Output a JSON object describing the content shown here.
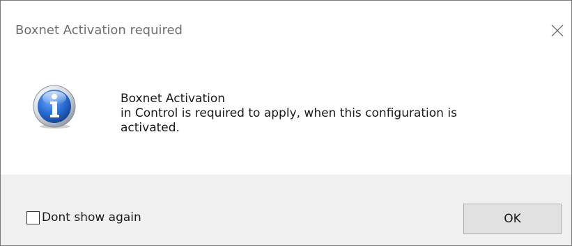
{
  "window": {
    "title": "Boxnet Activation required",
    "close_icon": "close-icon"
  },
  "content": {
    "icon": "info-icon",
    "message_lines": [
      "Boxnet Activation",
      "in Control is required to apply, when this configuration is",
      "activated."
    ]
  },
  "footer": {
    "checkbox_label": "Dont show again",
    "checkbox_checked": false,
    "ok_label": "OK"
  },
  "colors": {
    "title_text": "#6f6f6f",
    "footer_bg": "#f0f0f0",
    "button_bg": "#e1e1e1",
    "info_blue": "#1f5fb8"
  }
}
